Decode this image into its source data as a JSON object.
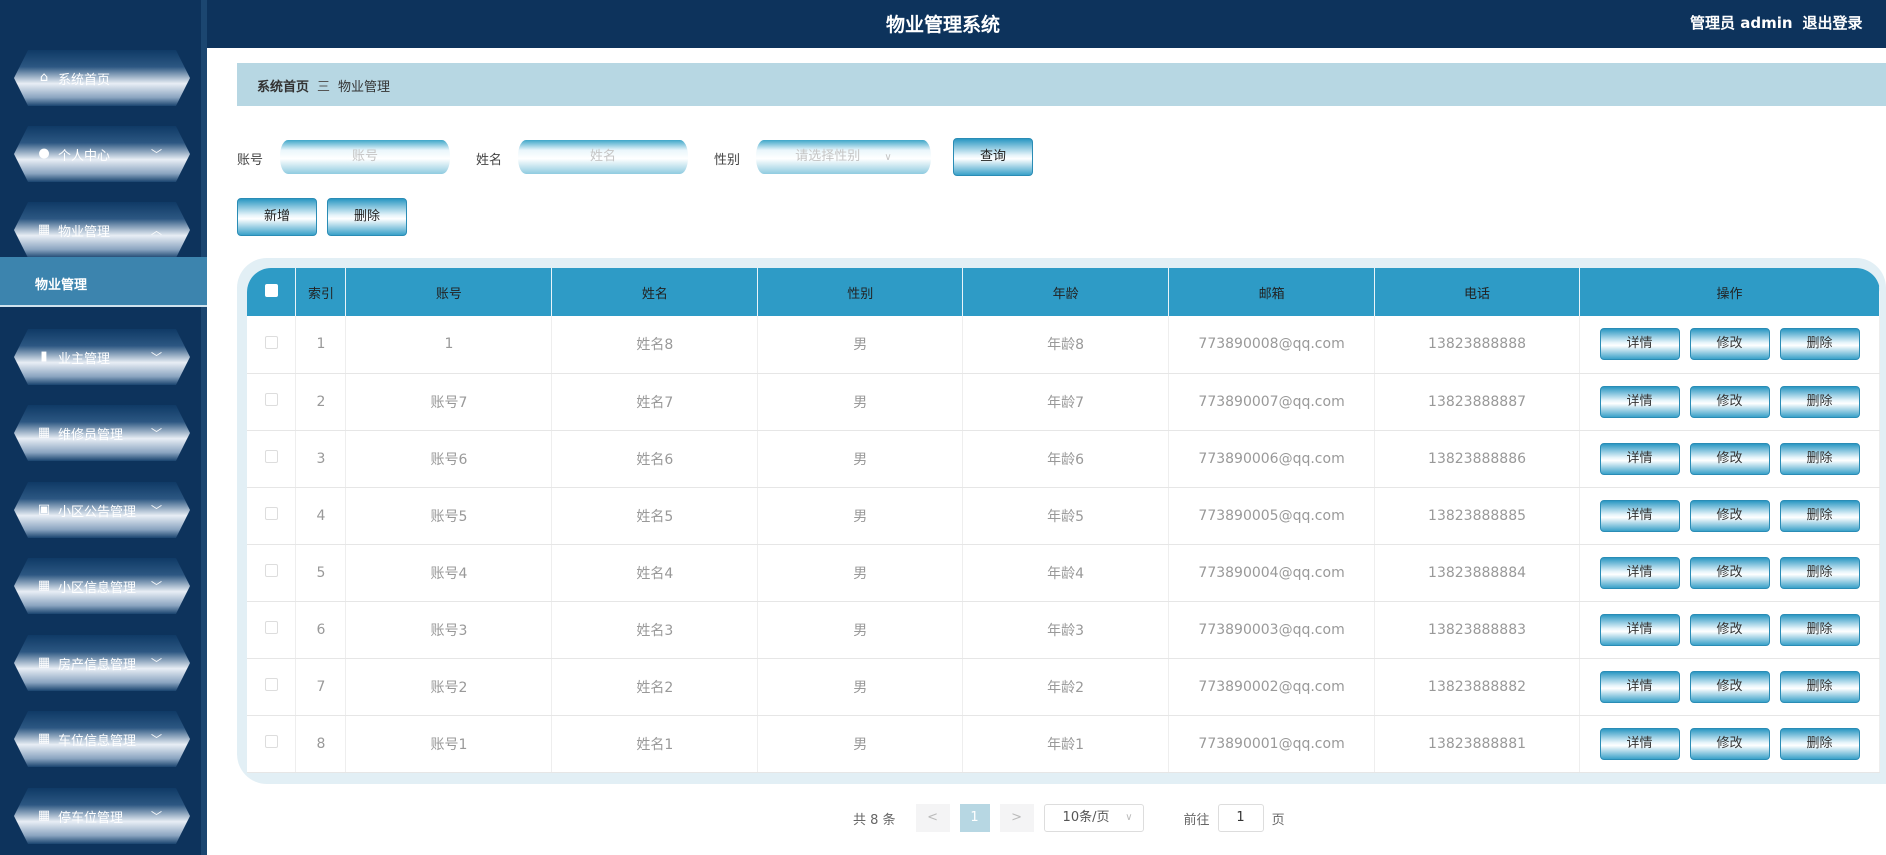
{
  "header": {
    "title": "物业管理系统",
    "user": "管理员 admin",
    "logout": "退出登录"
  },
  "sidebar": {
    "items": [
      {
        "label": "系统首页",
        "icon": "home-icon",
        "chev": ""
      },
      {
        "label": "个人中心",
        "icon": "user-icon",
        "chev": "﹀"
      },
      {
        "label": "物业管理",
        "icon": "grid-icon",
        "chev": "︿"
      },
      {
        "label": "业主管理",
        "icon": "bar-chart-icon",
        "chev": "﹀"
      },
      {
        "label": "维修员管理",
        "icon": "grid-icon",
        "chev": "﹀"
      },
      {
        "label": "小区公告管理",
        "icon": "clipboard-icon",
        "chev": "﹀"
      },
      {
        "label": "小区信息管理",
        "icon": "grid-icon",
        "chev": "﹀"
      },
      {
        "label": "房产信息管理",
        "icon": "grid-icon",
        "chev": "﹀"
      },
      {
        "label": "车位信息管理",
        "icon": "grid-icon",
        "chev": "﹀"
      },
      {
        "label": "停车位管理",
        "icon": "grid-icon",
        "chev": "﹀"
      }
    ],
    "sub_item": "物业管理"
  },
  "breadcrumb": {
    "home": "系统首页",
    "sep": "三",
    "current": "物业管理"
  },
  "search": {
    "account_label": "账号",
    "account_placeholder": "账号",
    "name_label": "姓名",
    "name_placeholder": "姓名",
    "gender_label": "性别",
    "gender_placeholder": "请选择性别",
    "query": "查询"
  },
  "actions": {
    "add": "新增",
    "delete": "删除"
  },
  "table": {
    "headers": [
      "索引",
      "账号",
      "姓名",
      "性别",
      "年龄",
      "邮箱",
      "电话",
      "操作"
    ],
    "rows": [
      [
        "1",
        "1",
        "姓名8",
        "男",
        "年龄8",
        "773890008@qq.com",
        "13823888888"
      ],
      [
        "2",
        "账号7",
        "姓名7",
        "男",
        "年龄7",
        "773890007@qq.com",
        "13823888887"
      ],
      [
        "3",
        "账号6",
        "姓名6",
        "男",
        "年龄6",
        "773890006@qq.com",
        "13823888886"
      ],
      [
        "4",
        "账号5",
        "姓名5",
        "男",
        "年龄5",
        "773890005@qq.com",
        "13823888885"
      ],
      [
        "5",
        "账号4",
        "姓名4",
        "男",
        "年龄4",
        "773890004@qq.com",
        "13823888884"
      ],
      [
        "6",
        "账号3",
        "姓名3",
        "男",
        "年龄3",
        "773890003@qq.com",
        "13823888883"
      ],
      [
        "7",
        "账号2",
        "姓名2",
        "男",
        "年龄2",
        "773890002@qq.com",
        "13823888882"
      ],
      [
        "8",
        "账号1",
        "姓名1",
        "男",
        "年龄1",
        "773890001@qq.com",
        "13823888881"
      ]
    ],
    "row_actions": [
      "详情",
      "修改",
      "删除"
    ]
  },
  "pagination": {
    "total": "共 8 条",
    "prev": "<",
    "current": "1",
    "next": ">",
    "page_size": "10条/页",
    "goto": "前往",
    "goto_value": "1",
    "page_suffix": "页"
  }
}
